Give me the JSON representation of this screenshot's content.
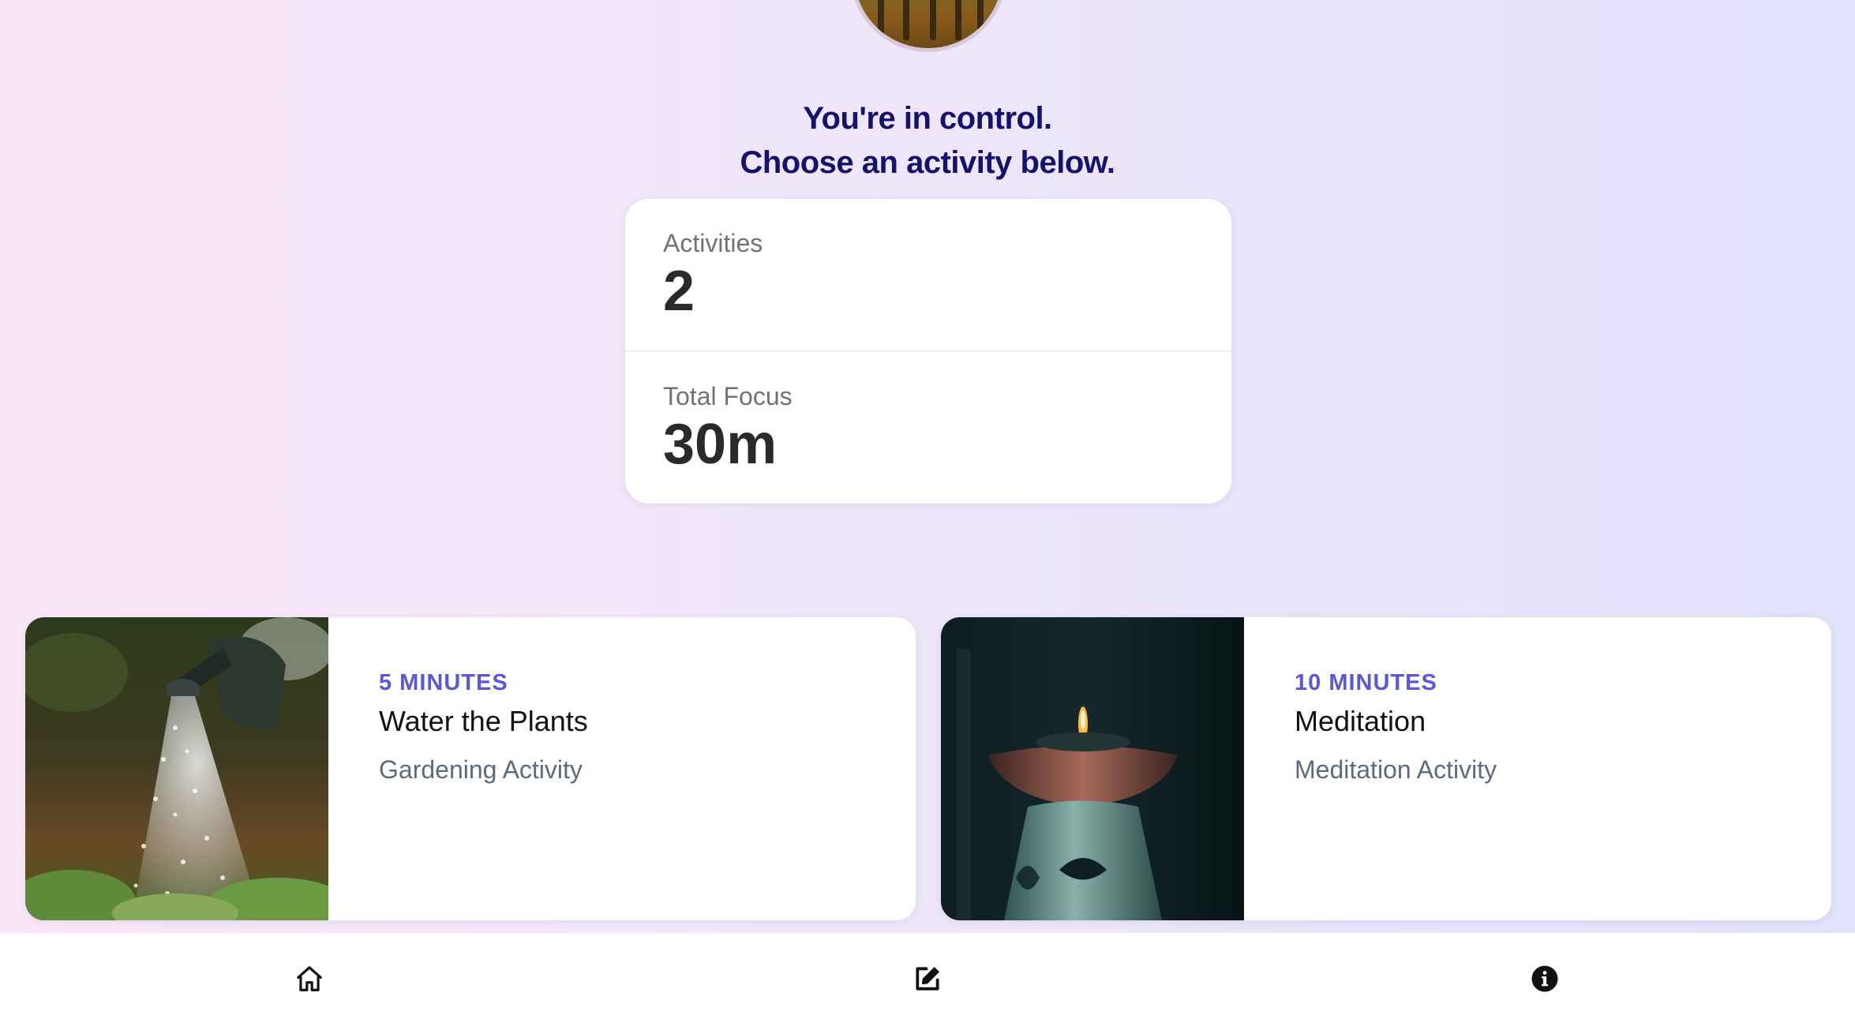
{
  "header": {
    "headline_line1": "You're in control.",
    "headline_line2": "Choose an activity below."
  },
  "stats": {
    "activities_label": "Activities",
    "activities_value": "2",
    "focus_label": "Total Focus",
    "focus_value": "30m"
  },
  "activities": [
    {
      "duration": "5 MINUTES",
      "title": "Water the Plants",
      "subtitle": "Gardening Activity"
    },
    {
      "duration": "10 MINUTES",
      "title": "Meditation",
      "subtitle": "Meditation Activity"
    }
  ],
  "nav": {
    "items": [
      "home-icon",
      "edit-icon",
      "info-icon"
    ]
  },
  "colors": {
    "headline": "#14126e",
    "accent": "#5b57db",
    "subtitle": "#5c6a80"
  }
}
